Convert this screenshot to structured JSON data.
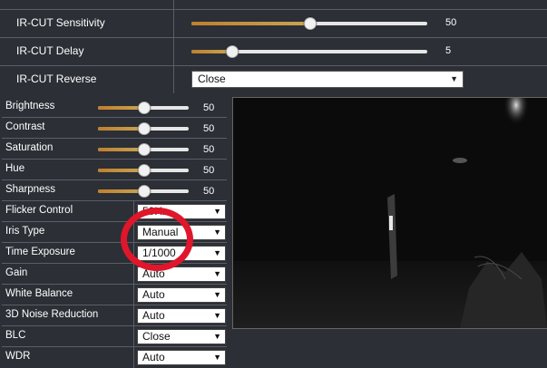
{
  "ir_cut": {
    "sensitivity": {
      "label": "IR-CUT Sensitivity",
      "value": "50",
      "level": 0.5
    },
    "delay": {
      "label": "IR-CUT Delay",
      "value": "5",
      "level": 0.17
    },
    "reverse": {
      "label": "IR-CUT Reverse",
      "selected": "Close"
    }
  },
  "image_settings": {
    "sliders": [
      {
        "label": "Brightness",
        "value": "50",
        "level": 0.5
      },
      {
        "label": "Contrast",
        "value": "50",
        "level": 0.5
      },
      {
        "label": "Saturation",
        "value": "50",
        "level": 0.5
      },
      {
        "label": "Hue",
        "value": "50",
        "level": 0.5
      },
      {
        "label": "Sharpness",
        "value": "50",
        "level": 0.5
      }
    ],
    "selects": [
      {
        "label": "Flicker Control",
        "selected": "50Hz"
      },
      {
        "label": "Iris Type",
        "selected": "Manual"
      },
      {
        "label": "Time Exposure",
        "selected": "1/1000"
      },
      {
        "label": "Gain",
        "selected": "Auto"
      },
      {
        "label": "White Balance",
        "selected": "Auto"
      },
      {
        "label": "3D Noise Reduction",
        "selected": "Auto"
      },
      {
        "label": "BLC",
        "selected": "Close"
      },
      {
        "label": "WDR",
        "selected": "Auto"
      }
    ]
  },
  "icons": {
    "dropdown_arrow": "▼"
  },
  "colors": {
    "background": "#2c2f35",
    "slider_fill": "#bf7f2f",
    "annotation": "#e0162b"
  }
}
